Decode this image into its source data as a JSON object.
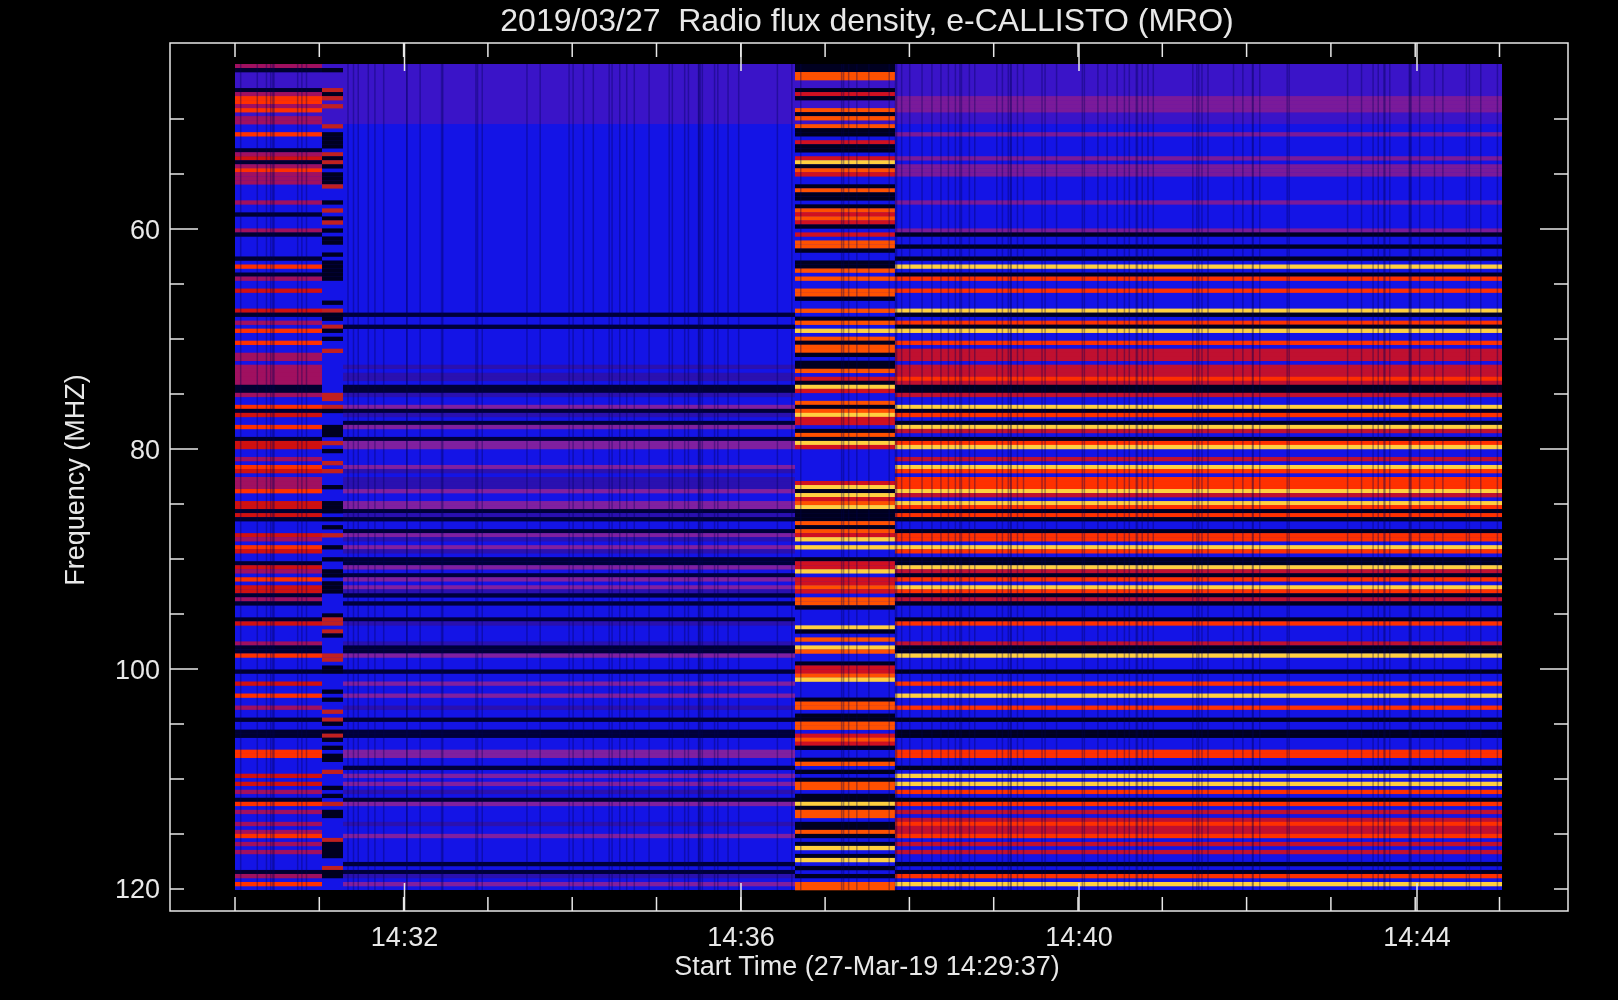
{
  "title": "2019/03/27  Radio flux density, e-CALLISTO (MRO)",
  "ylabel": "Frequency (MHZ)",
  "xlabel": "Start Time (27-Mar-19 14:29:37)",
  "yticks": [
    "60",
    "80",
    "100",
    "120"
  ],
  "xticks": [
    "14:32",
    "14:36",
    "14:40",
    "14:44"
  ]
}
